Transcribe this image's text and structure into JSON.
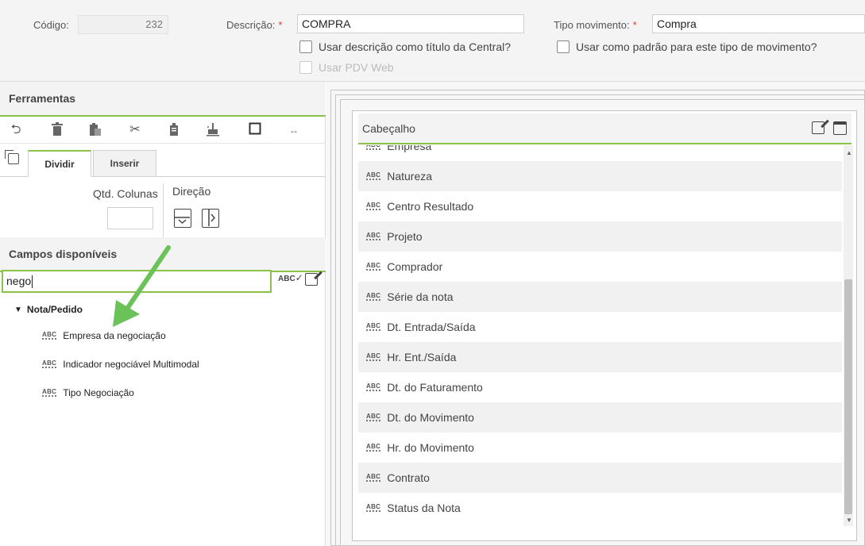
{
  "header": {
    "codigo_label": "Código:",
    "codigo_value": "232",
    "descricao_label": "Descrição:",
    "descricao_value": "COMPRA",
    "tipo_mov_label": "Tipo movimento:",
    "tipo_mov_value": "Compra",
    "required_mark": "*",
    "chk_titulo": "Usar descrição como título da Central?",
    "chk_padrao": "Usar como padrão para este tipo de movimento?",
    "chk_pdv": "Usar PDV Web"
  },
  "ferramentas": {
    "title": "Ferramentas",
    "tabs": [
      "Dividir",
      "Inserir"
    ],
    "qtd_colunas_label": "Qtd. Colunas",
    "direcao_label": "Direção"
  },
  "campos": {
    "title": "Campos disponíveis",
    "search_value": "nego",
    "group": "Nota/Pedido",
    "items": [
      "Empresa da negociação",
      "Indicador negociável Multimodal",
      "Tipo Negociação"
    ]
  },
  "cabecalho": {
    "title": "Cabeçalho",
    "rows": [
      "Empresa",
      "Natureza",
      "Centro Resultado",
      "Projeto",
      "Comprador",
      "Série da nota",
      "Dt. Entrada/Saída",
      "Hr. Ent./Saída",
      "Dt. do Faturamento",
      "Dt. do Movimento",
      "Hr. do Movimento",
      "Contrato",
      "Status da Nota"
    ]
  },
  "icons": {
    "abc": "ABC",
    "abc_check": "ABC"
  },
  "colors": {
    "accent": "#8bc34a",
    "required": "#e53935",
    "arrow": "#6ac259"
  }
}
